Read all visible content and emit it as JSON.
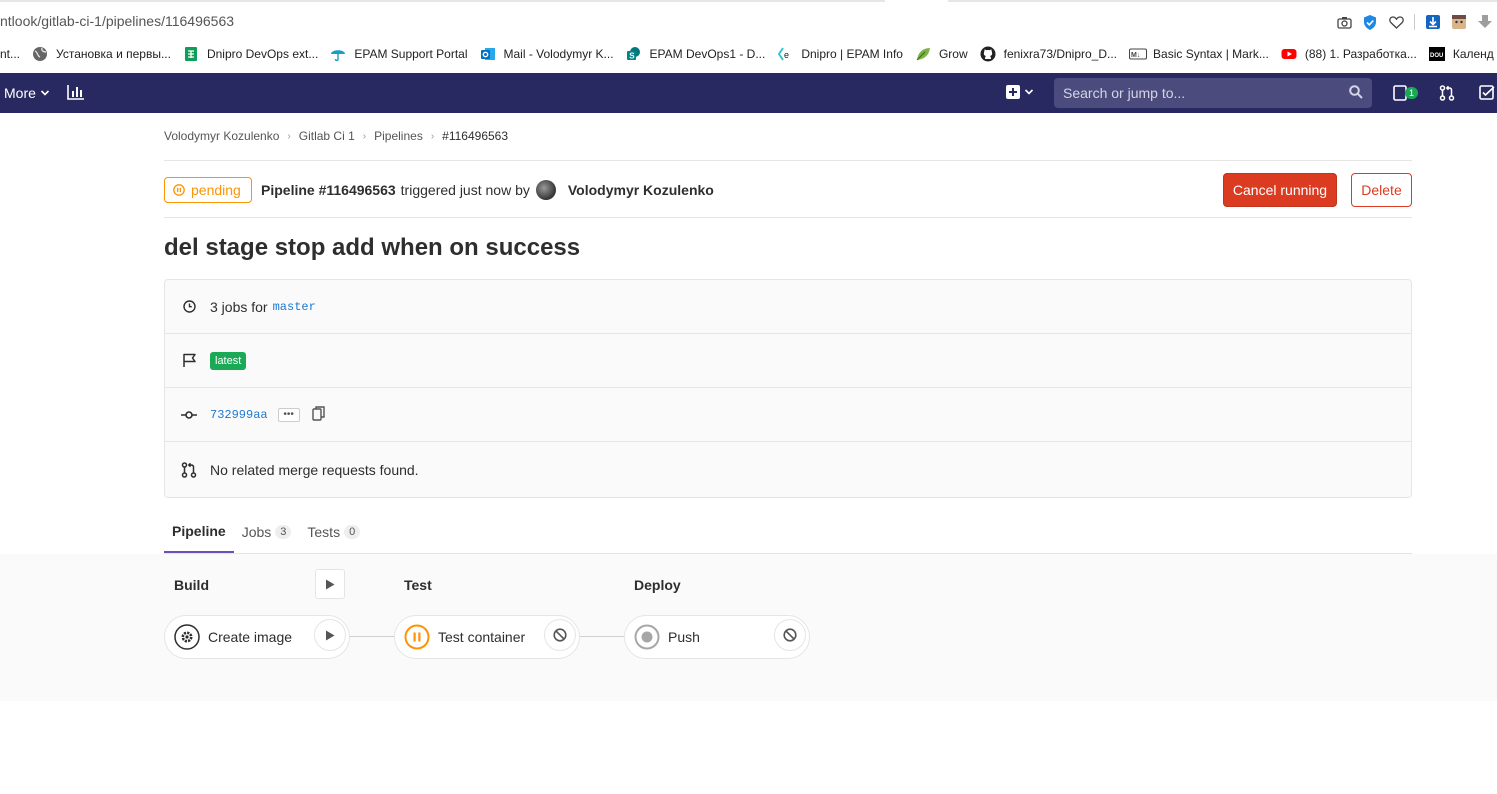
{
  "browser": {
    "url": "ntlook/gitlab-ci-1/pipelines/116496563",
    "bookmarks": [
      {
        "label": "nt...",
        "icon": "outlook-icon",
        "color": "#ffffff"
      },
      {
        "label": "Установка и первы...",
        "icon": "globe-icon",
        "color": "#555555"
      },
      {
        "label": "Dnipro DevOps ext...",
        "icon": "sheets-icon",
        "color": "#0f9d58"
      },
      {
        "label": "EPAM Support Portal",
        "icon": "umbrella-icon",
        "color": "#1a9fbd"
      },
      {
        "label": "Mail - Volodymyr K...",
        "icon": "outlook-icon",
        "color": "#0072c6"
      },
      {
        "label": "EPAM DevOps1 - D...",
        "icon": "sharepoint-icon",
        "color": "#038387"
      },
      {
        "label": "Dnipro | EPAM Info",
        "icon": "epam-icon",
        "color": "#39c2d7"
      },
      {
        "label": "Grow",
        "icon": "leaf-icon",
        "color": "#7cb342"
      },
      {
        "label": "fenixra73/Dnipro_D...",
        "icon": "github-icon",
        "color": "#222222"
      },
      {
        "label": "Basic Syntax | Mark...",
        "icon": "markdown-icon",
        "color": "#444444"
      },
      {
        "label": "(88) 1. Разработка...",
        "icon": "youtube-icon",
        "color": "#ff0000"
      },
      {
        "label": "Календ",
        "icon": "dou-icon",
        "color": "#000000"
      }
    ]
  },
  "navbar": {
    "more_label": "More",
    "search_placeholder": "Search or jump to...",
    "todo_count": "1"
  },
  "breadcrumbs": [
    "Volodymyr Kozulenko",
    "Gitlab Ci 1",
    "Pipelines",
    "#116496563"
  ],
  "header": {
    "status": "pending",
    "pipeline_label": "Pipeline #116496563",
    "triggered_text": "triggered just now by",
    "author": "Volodymyr Kozulenko",
    "cancel_label": "Cancel running",
    "delete_label": "Delete"
  },
  "title": "del stage stop add when on success",
  "info": {
    "jobs_text": "3 jobs for",
    "branch": "master",
    "tag": "latest",
    "commit_sha": "732999aa",
    "mr_text": "No related merge requests found."
  },
  "tabs": [
    {
      "label": "Pipeline",
      "count": null
    },
    {
      "label": "Jobs",
      "count": "3"
    },
    {
      "label": "Tests",
      "count": "0"
    }
  ],
  "stages": [
    {
      "name": "Build",
      "job": "Create image",
      "status": "manual",
      "action": "play"
    },
    {
      "name": "Test",
      "job": "Test container",
      "status": "pending",
      "action": "cancel"
    },
    {
      "name": "Deploy",
      "job": "Push",
      "status": "created",
      "action": "cancel"
    }
  ],
  "colors": {
    "navbar": "#292961",
    "pending": "#fc9403",
    "danger": "#db3b21",
    "success": "#1aaa55",
    "link": "#1f78d1",
    "active_tab": "#6b4fbb"
  }
}
